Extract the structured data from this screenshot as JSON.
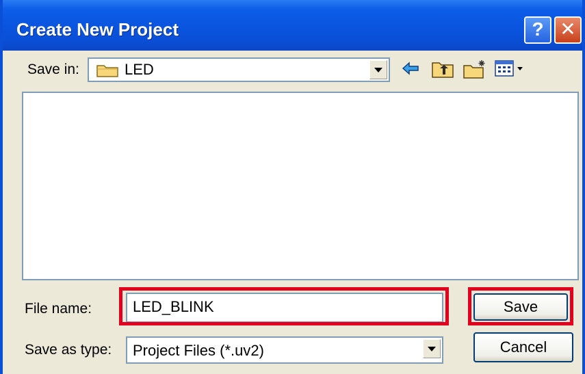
{
  "window": {
    "title": "Create New Project",
    "help_label": "?",
    "close_label": "✕"
  },
  "save_in": {
    "label": "Save in:",
    "value": "LED",
    "icon": "folder-icon"
  },
  "toolbar": {
    "icons": [
      "back-arrow-icon",
      "up-folder-icon",
      "new-folder-icon",
      "view-menu-icon"
    ]
  },
  "file_list": {
    "items": []
  },
  "file_name": {
    "label": "File name:",
    "value": "LED_BLINK"
  },
  "save_as_type": {
    "label": "Save as type:",
    "value": "Project Files (*.uv2)"
  },
  "buttons": {
    "save_label": "Save",
    "cancel_label": "Cancel"
  },
  "colors": {
    "titlebar": "#0a4fd6",
    "highlight": "#e4001c",
    "dialog_bg": "#ece9d8"
  }
}
